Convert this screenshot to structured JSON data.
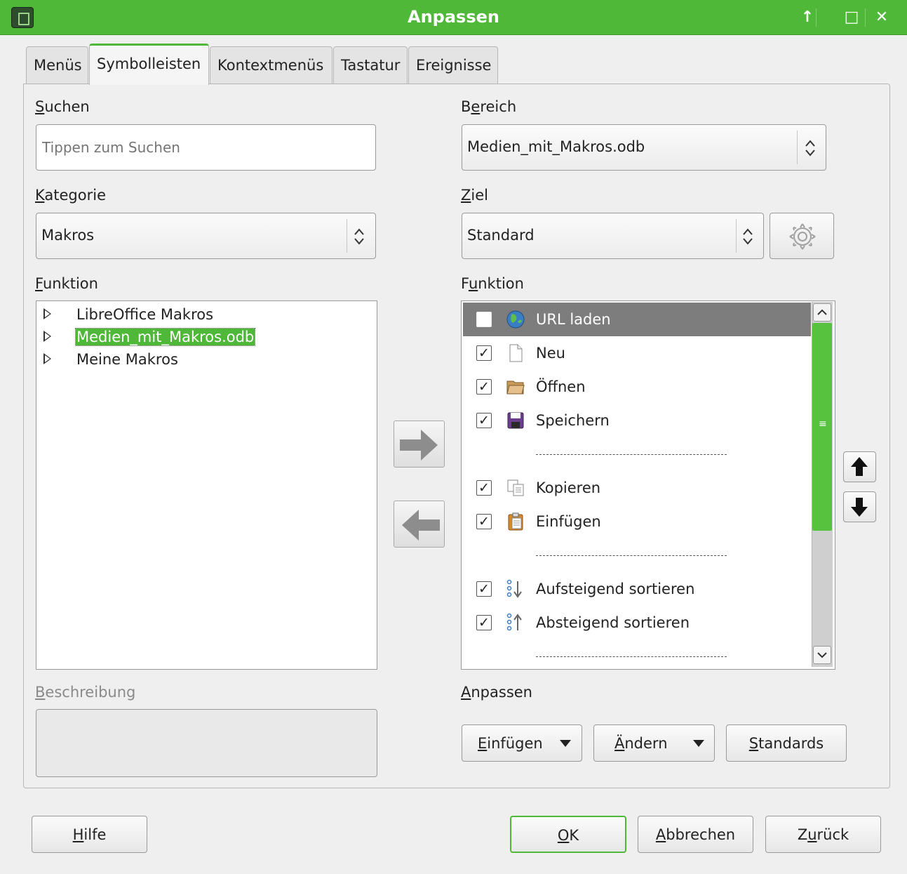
{
  "window": {
    "title": "Anpassen",
    "buttons": [
      "↑",
      "□",
      "✕"
    ]
  },
  "tabs": [
    {
      "label": "Menüs"
    },
    {
      "label": "Symbolleisten"
    },
    {
      "label": "Kontextmenüs"
    },
    {
      "label": "Tastatur"
    },
    {
      "label": "Ereignisse"
    }
  ],
  "left": {
    "search_label_u": "S",
    "search_label_rest": "uchen",
    "search_placeholder": "Tippen zum Suchen",
    "category_label_u": "K",
    "category_label_rest": "ategorie",
    "category_value": "Makros",
    "function_label_u": "F",
    "function_label_rest": "unktion",
    "tree": [
      {
        "label": "LibreOffice Makros"
      },
      {
        "label": "Medien_mit_Makros.odb"
      },
      {
        "label": "Meine Makros"
      }
    ],
    "description_label_u": "B",
    "description_label_rest": "eschreibung"
  },
  "right": {
    "scope_label_pre": "B",
    "scope_label_u": "e",
    "scope_label_rest": "reich",
    "scope_value": "Medien_mit_Makros.odb",
    "target_label_u": "Z",
    "target_label_rest": "iel",
    "target_value": "Standard",
    "function_label_pre": "F",
    "function_label_u": "u",
    "function_label_rest": "nktion",
    "entries": [
      {
        "label": "URL laden",
        "checked": false,
        "icon": "globe-icon"
      },
      {
        "label": "Neu",
        "checked": true,
        "icon": "new-document-icon"
      },
      {
        "label": "Öffnen",
        "checked": true,
        "icon": "folder-open-icon"
      },
      {
        "label": "Speichern",
        "checked": true,
        "icon": "save-icon"
      },
      {
        "label": "Kopieren",
        "checked": true,
        "icon": "copy-icon"
      },
      {
        "label": "Einfügen",
        "checked": true,
        "icon": "paste-icon"
      },
      {
        "label": "Aufsteigend sortieren",
        "checked": true,
        "icon": "sort-ascending-icon"
      },
      {
        "label": "Absteigend sortieren",
        "checked": true,
        "icon": "sort-descending-icon"
      }
    ],
    "customize_label_u": "A",
    "customize_label_rest": "npassen",
    "insert_btn_u": "E",
    "insert_btn_rest": "infügen",
    "modify_btn_u": "Ä",
    "modify_btn_rest": "ndern",
    "defaults_btn_u": "S",
    "defaults_btn_rest": "tandards"
  },
  "footer": {
    "help_u": "H",
    "help_rest": "ilfe",
    "ok_u": "O",
    "ok_rest": "K",
    "cancel_u": "A",
    "cancel_rest": "bbrechen",
    "reset_pre": "Z",
    "reset_u": "u",
    "reset_rest": "rück"
  },
  "colors": {
    "accent": "#4fb839",
    "selection": "#7d7d7d"
  }
}
